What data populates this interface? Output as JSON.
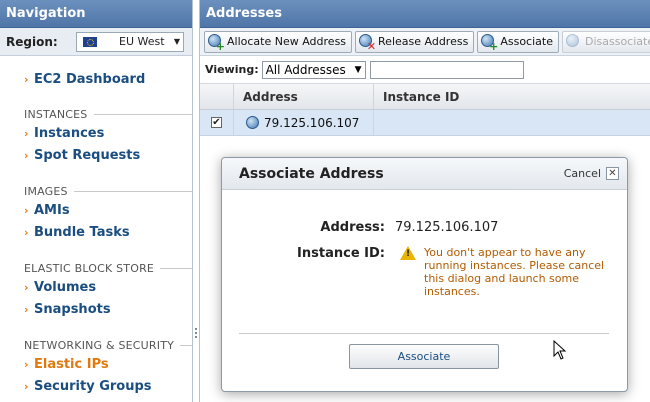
{
  "sidebar": {
    "title": "Navigation",
    "region": {
      "label": "Region:",
      "value": "EU West"
    },
    "dashboard": "EC2 Dashboard",
    "sections": [
      {
        "title": "INSTANCES",
        "items": [
          "Instances",
          "Spot Requests"
        ]
      },
      {
        "title": "IMAGES",
        "items": [
          "AMIs",
          "Bundle Tasks"
        ]
      },
      {
        "title": "ELASTIC BLOCK STORE",
        "items": [
          "Volumes",
          "Snapshots"
        ]
      },
      {
        "title": "NETWORKING & SECURITY",
        "items": [
          "Elastic IPs",
          "Security Groups"
        ]
      }
    ],
    "active_item": "Elastic IPs",
    "colors": {
      "link": "#1a4d80",
      "active": "#e07a10",
      "header": "#5a80b2"
    }
  },
  "main": {
    "title": "Addresses",
    "toolbar": {
      "allocate": "Allocate New Address",
      "release": "Release Address",
      "associate": "Associate",
      "disassociate": "Disassociate"
    },
    "viewing": {
      "label": "Viewing:",
      "value": "All Addresses",
      "filter_value": ""
    },
    "grid": {
      "columns": [
        "Address",
        "Instance ID"
      ],
      "rows": [
        {
          "address": "79.125.106.107",
          "instance_id": "",
          "checked": true
        }
      ]
    }
  },
  "dialog": {
    "title": "Associate Address",
    "cancel": "Cancel",
    "close_glyph": "✕",
    "address_label": "Address:",
    "address_value": "79.125.106.107",
    "instance_label": "Instance ID:",
    "warning": "You don't appear to have any running instances. Please cancel this dialog and launch some instances.",
    "button": "Associate"
  },
  "icons": {
    "dropdown": "▼",
    "chevron": "›",
    "check": "✔",
    "warning_mark": "!"
  }
}
